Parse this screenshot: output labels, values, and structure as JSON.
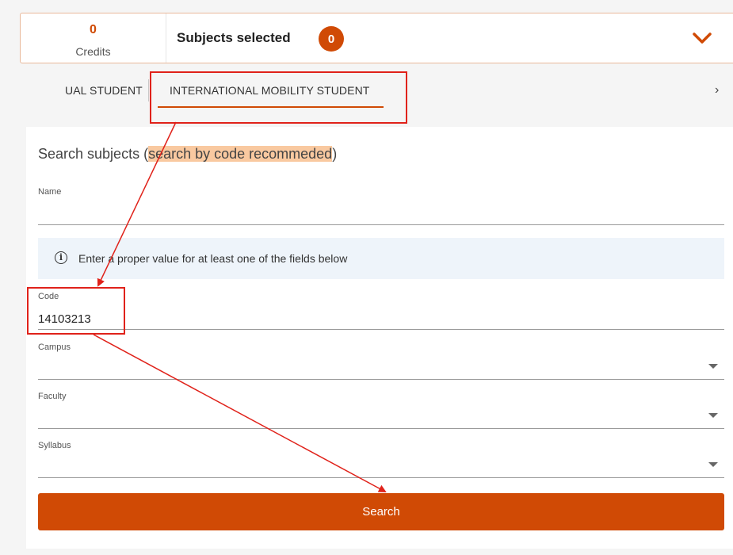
{
  "summary": {
    "credits_value": "0",
    "credits_label": "Credits",
    "subjects_title": "Subjects selected",
    "subjects_count": "0"
  },
  "tabs": [
    {
      "label": "UAL STUDENT",
      "active": false
    },
    {
      "label": "INTERNATIONAL MOBILITY STUDENT",
      "active": true
    }
  ],
  "search": {
    "heading_prefix": "Search subjects (",
    "heading_highlight": "search by code recommeded",
    "heading_suffix": ")",
    "name_label": "Name",
    "name_value": "",
    "info_text": "Enter a proper value for at least one of the fields below",
    "code_label": "Code",
    "code_value": "14103213",
    "campus_label": "Campus",
    "campus_value": "",
    "faculty_label": "Faculty",
    "faculty_value": "",
    "syllabus_label": "Syllabus",
    "syllabus_value": "",
    "button_label": "Search"
  },
  "colors": {
    "accent": "#d04a05",
    "annotation": "#e0221a",
    "highlight": "#f9c9a0",
    "info_bg": "#eef4fa"
  },
  "icons": {
    "expand": "chevron-down-icon",
    "tabs_next": "chevron-right-icon",
    "info": "info-icon",
    "dropdown": "caret-down-icon"
  }
}
